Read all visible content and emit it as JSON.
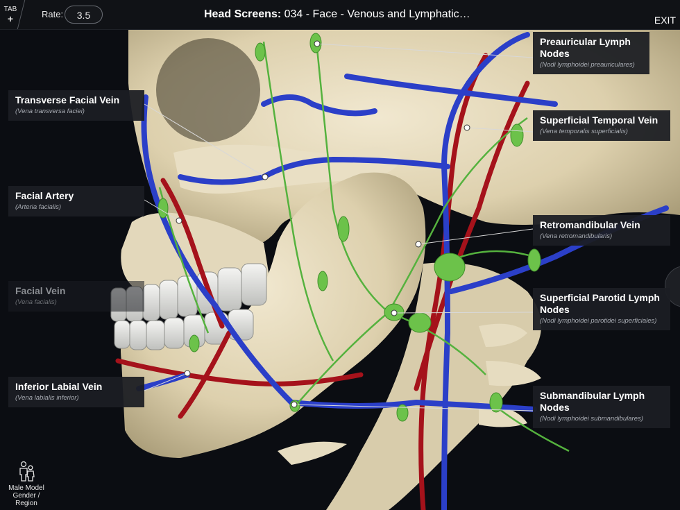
{
  "toolbar": {
    "tab_label": "TAB",
    "tab_plus": "+",
    "rate_label": "Rate:",
    "rate_value": "3.5",
    "title_bold": "Head Screens:",
    "title_rest": " 034 - Face - Venous and Lymphatic…",
    "exit_label": "EXIT"
  },
  "labels": [
    {
      "id": "preauricular",
      "name": "Preauricular Lymph Nodes",
      "latin": "(Nodi lymphoidei preauriculares)"
    },
    {
      "id": "transverse-facial-vein",
      "name": "Transverse Facial Vein",
      "latin": "(Vena transversa faciei)"
    },
    {
      "id": "superficial-temporal-vein",
      "name": "Superficial Temporal Vein",
      "latin": "(Vena temporalis superficialis)"
    },
    {
      "id": "facial-artery",
      "name": "Facial Artery",
      "latin": "(Arteria facialis)"
    },
    {
      "id": "retromandibular-vein",
      "name": "Retromandibular Vein",
      "latin": "(Vena retromandibularis)"
    },
    {
      "id": "facial-vein",
      "name": "Facial Vein",
      "latin": "(Vena facialis)"
    },
    {
      "id": "superficial-parotid",
      "name": "Superficial Parotid Lymph Nodes",
      "latin": "(Nodi lymphoidei parotidei superficiales)"
    },
    {
      "id": "inferior-labial-vein",
      "name": "Inferior Labial Vein",
      "latin": "(Vena labialis inferior)"
    },
    {
      "id": "submandibular",
      "name": "Submandibular Lymph Nodes",
      "latin": "(Nodi lymphoidei submandibulares)"
    }
  ],
  "model_button": {
    "line1": "Male Model",
    "line2": "Gender /",
    "line3": "Region",
    "icon": "people-icon"
  },
  "colors": {
    "bone": "#e6dcc2",
    "vein": "#2b3fc8",
    "artery": "#a5121b",
    "lymph": "#6cc24a",
    "label_bg": "#1c1e23"
  }
}
